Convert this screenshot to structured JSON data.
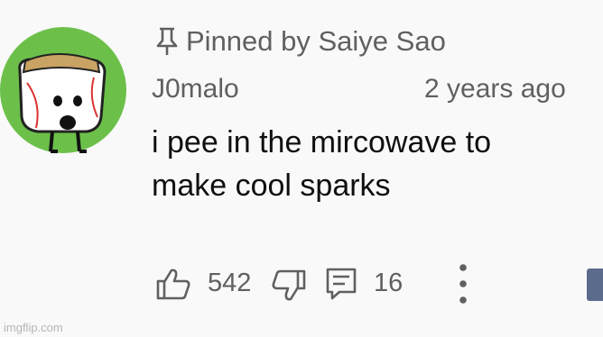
{
  "comment": {
    "pinned_text": "Pinned by Saiye Sao",
    "author": "J0malo",
    "timestamp": "2 years ago",
    "body_line1": "i pee in the mircowave to",
    "body_line2": "make cool sparks",
    "like_count": "542",
    "reply_count": "16"
  },
  "icons": {
    "pin": "pin-icon",
    "like": "thumbs-up-icon",
    "dislike": "thumbs-down-icon",
    "reply": "reply-comment-icon",
    "more": "more-vertical-icon"
  },
  "colors": {
    "background": "#f9f9f9",
    "text_primary": "#0f0f0f",
    "text_secondary": "#606060",
    "avatar_ring": "#6cc04a"
  },
  "watermark": "imgflip.com"
}
